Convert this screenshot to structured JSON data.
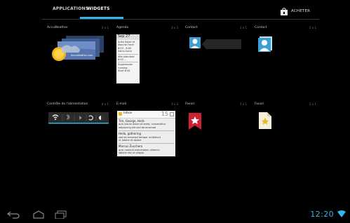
{
  "tabs": [
    {
      "label": "APPLICATIONS"
    },
    {
      "label": "WIDGETS"
    }
  ],
  "store": {
    "label": "ACHETER"
  },
  "widgets_row1": [
    {
      "name": "AccuWeather",
      "size": "3 x 1",
      "image_label": "AccuWeather.com"
    },
    {
      "name": "Agenda",
      "size": "3 x 3",
      "preview_header": "Sep 27",
      "preview_lines": [
        "Suite Soleil et",
        "Marché Ferré",
        "6:03 - 8:00",
        "Saint-Guire",
        "Vite standard",
        "6:03 ...",
        "Suppression",
        "running",
        "Start 6:45"
      ]
    },
    {
      "name": "Contact",
      "size": "1 x 1"
    },
    {
      "name": "Contact",
      "size": "1 x 1"
    }
  ],
  "widgets_row2": [
    {
      "name": "Contrôle de l'alimentation",
      "size": "4 x 1"
    },
    {
      "name": "E-mail",
      "size": "3 x 3",
      "inbox_title": "Inbox",
      "inbox_count": "15",
      "messages": [
        {
          "from": "Tim, George, Herb",
          "line1": "quis ipsum dolor sit amet, consectetur",
          "line2": "adipiscing elit sed do eiusmod"
        },
        {
          "from": "Hello, gathering",
          "line1": "sed do eiusmod tempor incididunt",
          "line2": "ut labore et dolore"
        },
        {
          "from": "Marcus Zucchero",
          "line1": "quis nostrud exercitation ullamco",
          "line2": "laboris nisi ut aliquip"
        }
      ]
    },
    {
      "name": "Favori",
      "size": "1 x 1"
    },
    {
      "name": "Favori",
      "size": "1 x 1"
    }
  ],
  "status": {
    "time": "12:20"
  },
  "colors": {
    "accent": "#33b5e5",
    "bookmark_red": "#cc2233",
    "bookmark_yellow": "#f0b428"
  }
}
